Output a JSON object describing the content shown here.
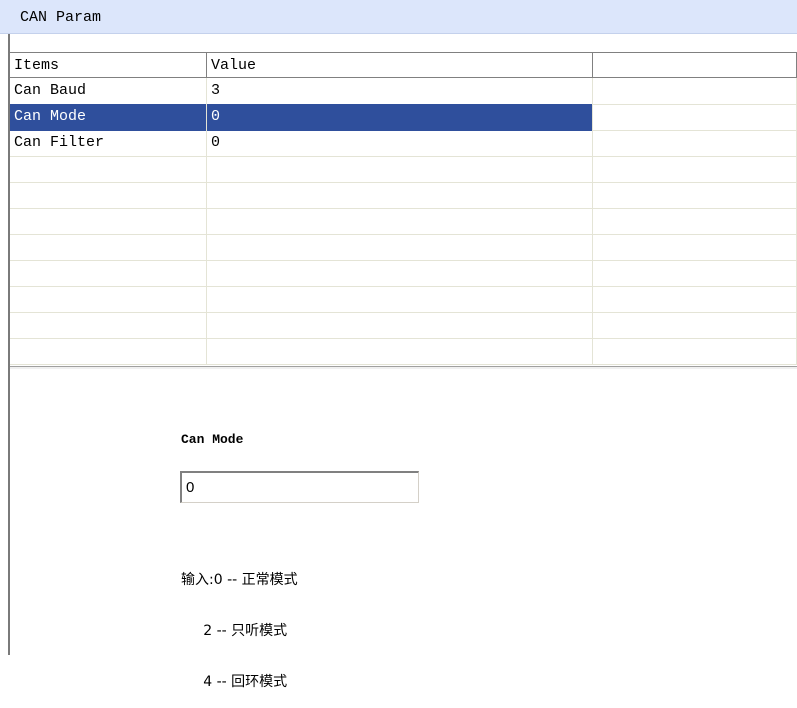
{
  "panel": {
    "title": "CAN Param"
  },
  "grid": {
    "headers": [
      "Items",
      "Value",
      ""
    ],
    "rows": [
      {
        "item": "Can Baud",
        "value": "3",
        "extra": "",
        "selected": false
      },
      {
        "item": "Can Mode",
        "value": "0",
        "extra": "",
        "selected": true
      },
      {
        "item": "Can Filter",
        "value": "0",
        "extra": "",
        "selected": false
      },
      {
        "item": "",
        "value": "",
        "extra": "",
        "selected": false
      },
      {
        "item": "",
        "value": "",
        "extra": "",
        "selected": false
      },
      {
        "item": "",
        "value": "",
        "extra": "",
        "selected": false
      },
      {
        "item": "",
        "value": "",
        "extra": "",
        "selected": false
      },
      {
        "item": "",
        "value": "",
        "extra": "",
        "selected": false
      },
      {
        "item": "",
        "value": "",
        "extra": "",
        "selected": false
      },
      {
        "item": "",
        "value": "",
        "extra": "",
        "selected": false
      },
      {
        "item": "",
        "value": "",
        "extra": "",
        "selected": false
      }
    ]
  },
  "detail": {
    "label": "Can Mode",
    "input_value": "0",
    "hint_lines": [
      "输入:0 -- 正常模式",
      "     2 -- 只听模式",
      "     4 -- 回环模式"
    ]
  },
  "colors": {
    "title_bg": "#dce6fb",
    "selection_bg": "#2f4f9c",
    "selection_fg": "#ffffff",
    "grid_line": "#e4e4d6"
  }
}
